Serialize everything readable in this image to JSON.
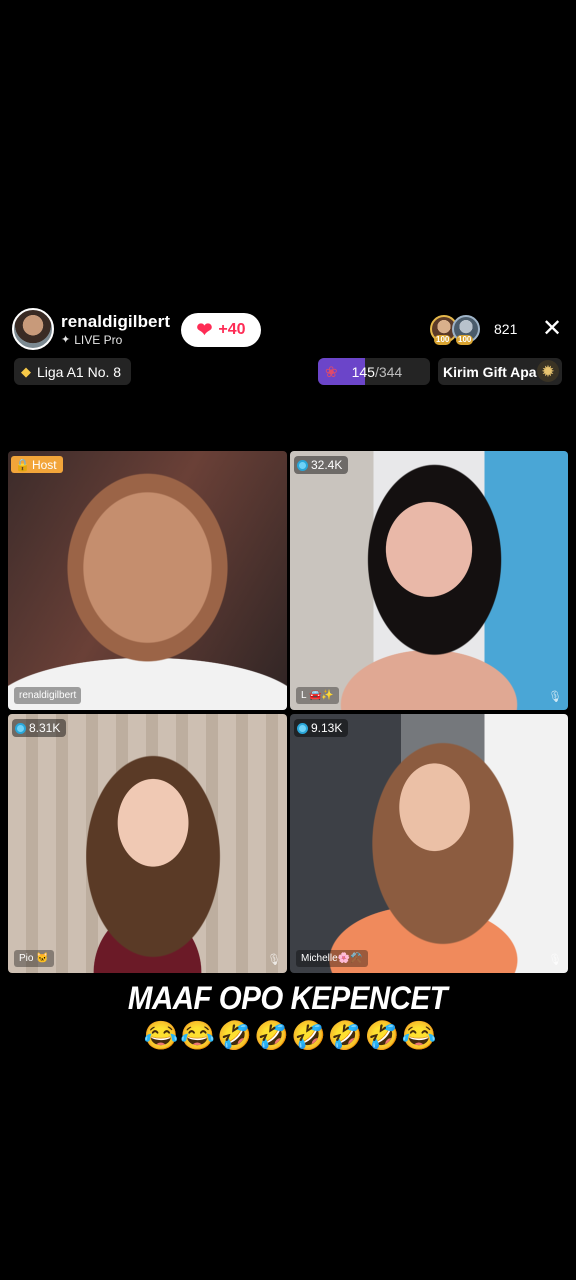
{
  "host": {
    "name": "renaldigilbert",
    "subtitle": "LIVE Pro",
    "like_count": "+40"
  },
  "viewers": {
    "badge_1": "100",
    "badge_2": "100",
    "count": "821"
  },
  "league": {
    "label": "Liga A1 No. 8"
  },
  "goal": {
    "current": "145",
    "total": "/344",
    "progress": 0.42
  },
  "gift_banner": {
    "text": "Kirim Gift Apa"
  },
  "tiles": [
    {
      "badge": "Host",
      "name": "renaldigilbert"
    },
    {
      "badge": "32.4K",
      "name": "L 🚘✨"
    },
    {
      "badge": "8.31K",
      "name": "Pio 🐱"
    },
    {
      "badge": "9.13K",
      "name": "Michelle🌸⚒️"
    }
  ],
  "caption": {
    "text": "MAAF OPO KEPENCET",
    "emojis": "😂😂🤣🤣🤣🤣🤣😂"
  },
  "icons": {
    "heart": "heart-icon",
    "diamond": "diamond-icon",
    "rose": "rose-icon",
    "close": "close-icon",
    "mute": "muted-mic-icon"
  },
  "colors": {
    "like": "#fe2c55",
    "host_badge": "#f2a53a",
    "goal_fill": "#6b45c9",
    "viewer_dot": "#6fd2f7"
  }
}
